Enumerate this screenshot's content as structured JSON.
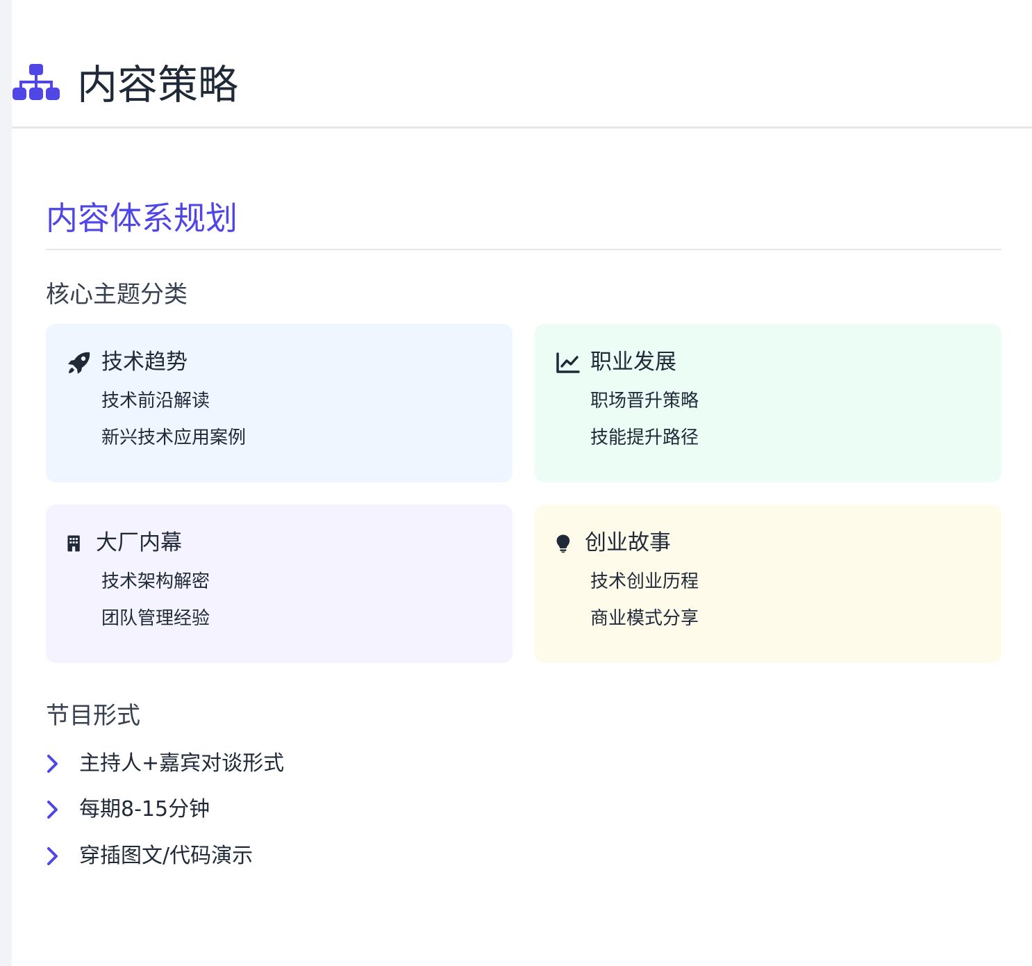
{
  "header": {
    "icon": "sitemap-icon",
    "title": "内容策略"
  },
  "section": {
    "title": "内容体系规划"
  },
  "core_topics": {
    "heading": "核心主题分类",
    "cards": [
      {
        "icon": "rocket-icon",
        "title": "技术趋势",
        "items": [
          "技术前沿解读",
          "新兴技术应用案例"
        ],
        "bg": "#eff6ff"
      },
      {
        "icon": "line-chart-icon",
        "title": "职业发展",
        "items": [
          "职场晋升策略",
          "技能提升路径"
        ],
        "bg": "#ecfdf5"
      },
      {
        "icon": "building-icon",
        "title": "大厂内幕",
        "items": [
          "技术架构解密",
          "团队管理经验"
        ],
        "bg": "#f5f3ff"
      },
      {
        "icon": "lightbulb-icon",
        "title": "创业故事",
        "items": [
          "技术创业历程",
          "商业模式分享"
        ],
        "bg": "#fffbeb"
      }
    ]
  },
  "program_format": {
    "heading": "节目形式",
    "items": [
      "主持人+嘉宾对谈形式",
      "每期8-15分钟",
      "穿插图文/代码演示"
    ]
  },
  "colors": {
    "accent": "#4f46e5",
    "text": "#1f2937",
    "divider": "#e5e7eb"
  }
}
